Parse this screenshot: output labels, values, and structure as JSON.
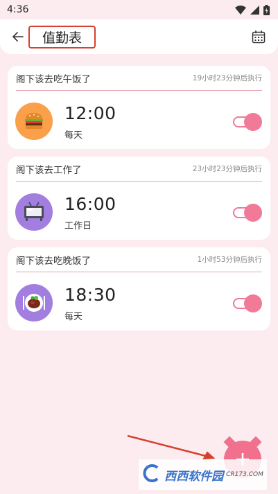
{
  "status_bar": {
    "time": "4:36",
    "icons": [
      "wifi-icon",
      "signal-icon",
      "battery-icon"
    ]
  },
  "header": {
    "title": "值勤表",
    "back_icon": "back-arrow-icon",
    "calendar_icon": "calendar-icon"
  },
  "alarms": [
    {
      "title": "阁下该去吃午饭了",
      "countdown": "19小时23分钟后执行",
      "time": "12:00",
      "repeat": "每天",
      "icon": "burger-icon",
      "icon_bg": "#fba04a",
      "enabled": true
    },
    {
      "title": "阁下该去工作了",
      "countdown": "23小时23分钟后执行",
      "time": "16:00",
      "repeat": "工作日",
      "icon": "monitor-icon",
      "icon_bg": "#a17ee0",
      "enabled": true
    },
    {
      "title": "阁下该去吃晚饭了",
      "countdown": "1小时53分钟后执行",
      "time": "18:30",
      "repeat": "每天",
      "icon": "steak-plate-icon",
      "icon_bg": "#a17ee0",
      "enabled": true
    }
  ],
  "fab": {
    "icon": "plus-icon"
  },
  "watermark": {
    "main": "西西软件园",
    "sub": "CR173.COM"
  },
  "colors": {
    "accent": "#f07a98",
    "background": "#fcecef",
    "highlight_border": "#d7402e",
    "annotation_arrow": "#d7402e"
  }
}
